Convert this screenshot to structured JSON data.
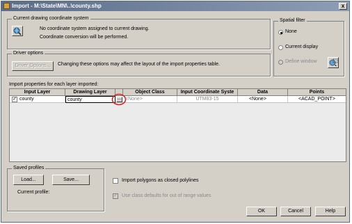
{
  "window": {
    "title": "Import - M:\\State\\MN\\..\\county.shp",
    "close_label": "x"
  },
  "coordinate_system": {
    "group_label": "Current drawing coordinate system",
    "line1": "No coordinate system assigned to current drawing.",
    "line2": "Coordinate conversion will be performed."
  },
  "spatial_filter": {
    "group_label": "Spatial filter",
    "options": [
      {
        "label": "None",
        "selected": true,
        "enabled": true
      },
      {
        "label": "Current display",
        "selected": false,
        "enabled": true
      },
      {
        "label": "Define window",
        "selected": false,
        "enabled": false
      }
    ]
  },
  "driver_options": {
    "group_label": "Driver options",
    "button_label": "Driver Options...",
    "description": "Changing these options may affect the layout of the import properties table."
  },
  "import_properties": {
    "label": "Import properties for each layer imported:",
    "columns": [
      "Input Layer",
      "Drawing Layer",
      "",
      "Object Class",
      "Input Coordinate Syste",
      "Data",
      "Points"
    ],
    "rows": [
      {
        "checked": true,
        "input_layer": "county",
        "drawing_layer": "county",
        "picker_label": "...",
        "object_class": "<None>",
        "coordinate_system": "UTM83-15",
        "data": "<None>",
        "points": "<ACAD_POINT>"
      }
    ]
  },
  "saved_profiles": {
    "group_label": "Saved profiles",
    "load_label": "Load...",
    "save_label": "Save...",
    "current_profile_label": "Current profile:"
  },
  "options": {
    "closed_polylines": {
      "label": "Import polygons as closed polylines",
      "checked": false,
      "enabled": true
    },
    "class_defaults": {
      "label": "Use class defaults for out of range values",
      "checked": true,
      "enabled": false
    }
  },
  "footer": {
    "ok_label": "OK",
    "cancel_label": "Cancel",
    "help_label": "Help"
  },
  "colors": {
    "titlebar": "#5c6d8a",
    "dialog_bg": "#d4d0c8",
    "highlight_circle": "#e02020"
  }
}
